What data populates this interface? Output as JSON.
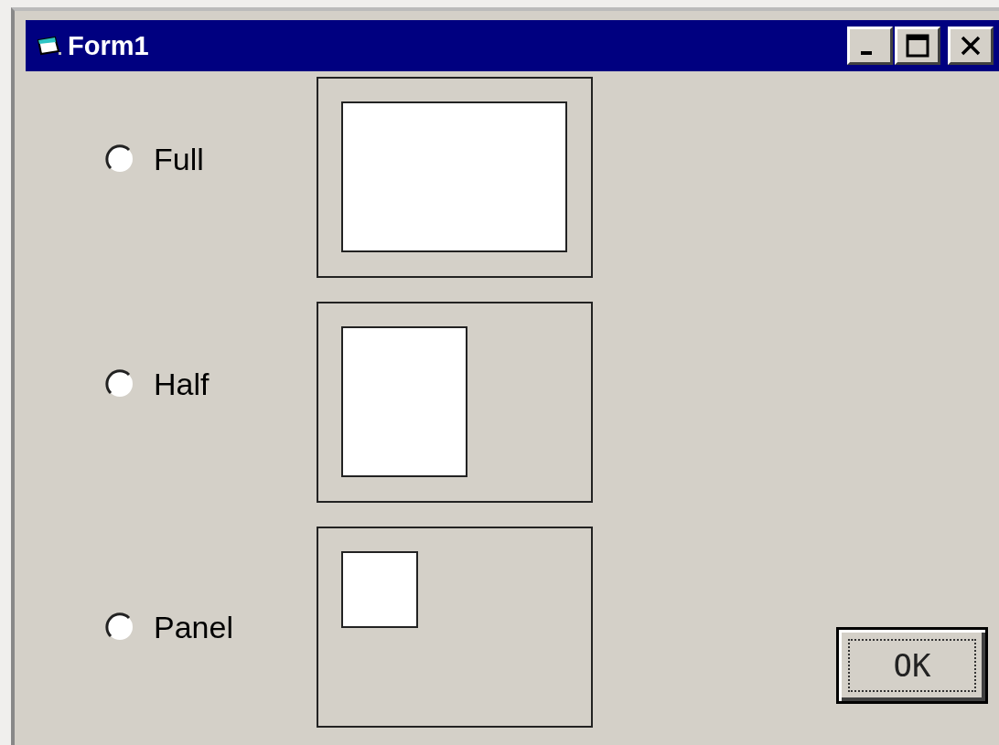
{
  "window": {
    "title": "Form1"
  },
  "options": [
    {
      "label": "Full",
      "selected": false,
      "kind": "full"
    },
    {
      "label": "Half",
      "selected": false,
      "kind": "half"
    },
    {
      "label": "Panel",
      "selected": false,
      "kind": "panel"
    }
  ],
  "button": {
    "label": "OK",
    "focused": true
  }
}
